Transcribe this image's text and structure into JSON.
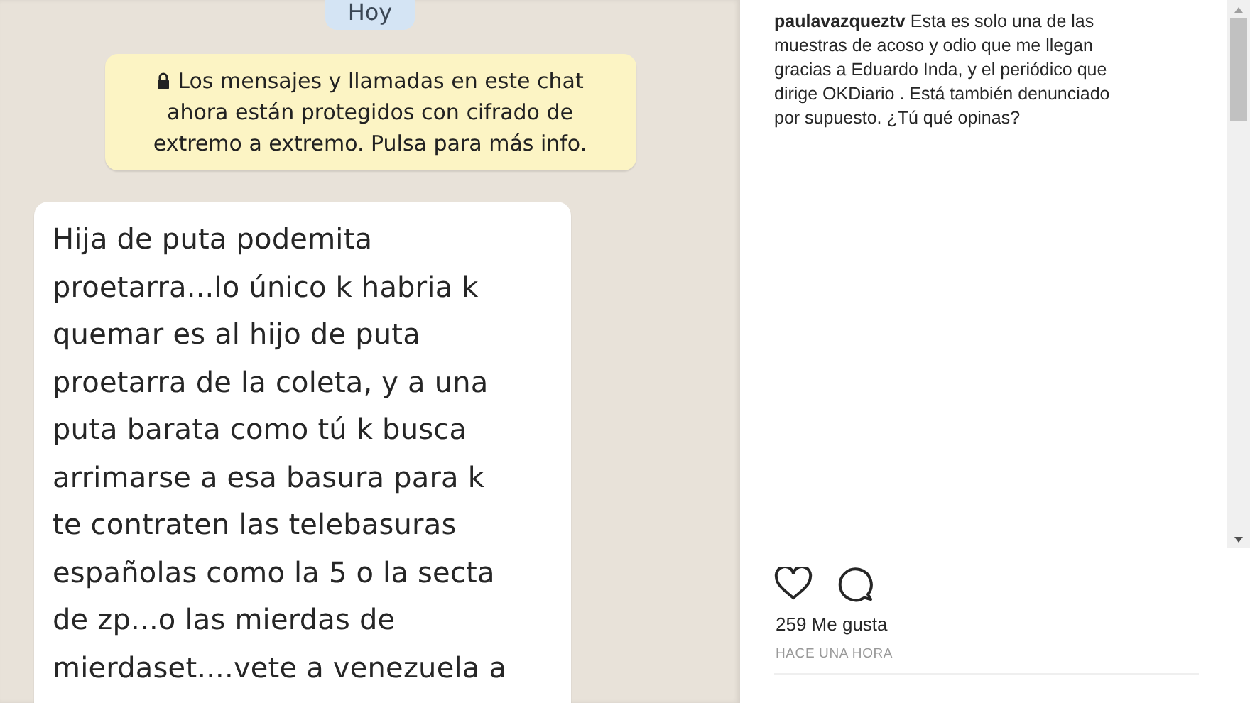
{
  "chat": {
    "date_chip": "Hoy",
    "encryption_notice": "Los mensajes y llamadas en este chat ahora están protegidos con cifrado de extremo a extremo. Pulsa para más info.",
    "message_lines": [
      "Hija de puta podemita",
      "proetarra...lo único k habria k",
      "quemar es al hijo de puta",
      "proetarra de la coleta, y a una",
      "puta barata como tú k busca",
      "arrimarse a esa basura para k",
      "te contraten las telebasuras",
      "españolas como la 5 o la secta",
      "de zp...o las mierdas de",
      "mierdaset....vete a venezuela a"
    ]
  },
  "post": {
    "caption": "**paulavazqueztv** Esta es solo una de las muestras de acoso y odio que me llegan gracias a Eduardo Inda, y el periódico que dirige OKDiario . Está también denunciado por supuesto. ¿Tú qué opinas?",
    "liked": false,
    "likes": "259 Me gusta",
    "time": "HACE UNA HORA"
  }
}
